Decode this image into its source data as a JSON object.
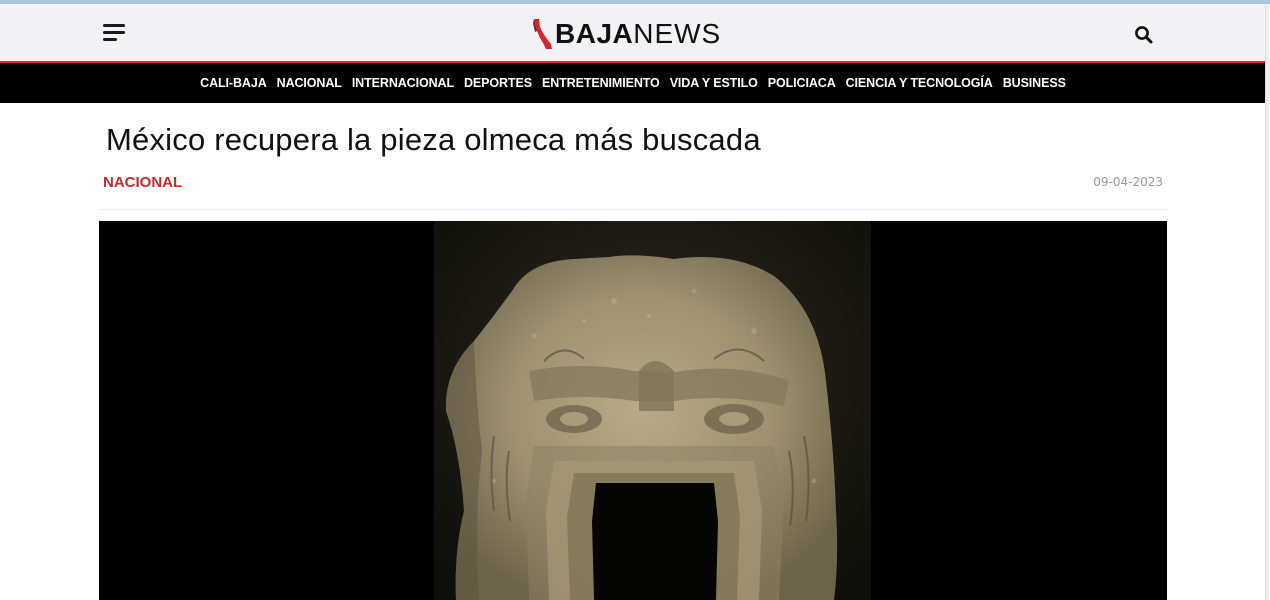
{
  "header": {
    "logo_part1": "BAJA",
    "logo_part2": "NEWS",
    "menu_icon": "hamburger-menu-icon",
    "search_icon": "search-icon"
  },
  "nav": {
    "items": [
      "CALI-BAJA",
      "NACIONAL",
      "INTERNACIONAL",
      "DEPORTES",
      "ENTRETENIMIENTO",
      "VIDA Y ESTILO",
      "POLICIACA",
      "CIENCIA Y TECNOLOGÍA",
      "BUSINESS"
    ]
  },
  "article": {
    "title": "México recupera la pieza olmeca más buscada",
    "category": "NACIONAL",
    "date": "09-04-2023"
  },
  "colors": {
    "accent_red": "#c62a2f",
    "nav_bg": "#000000",
    "header_bg": "#f3f3f5"
  }
}
